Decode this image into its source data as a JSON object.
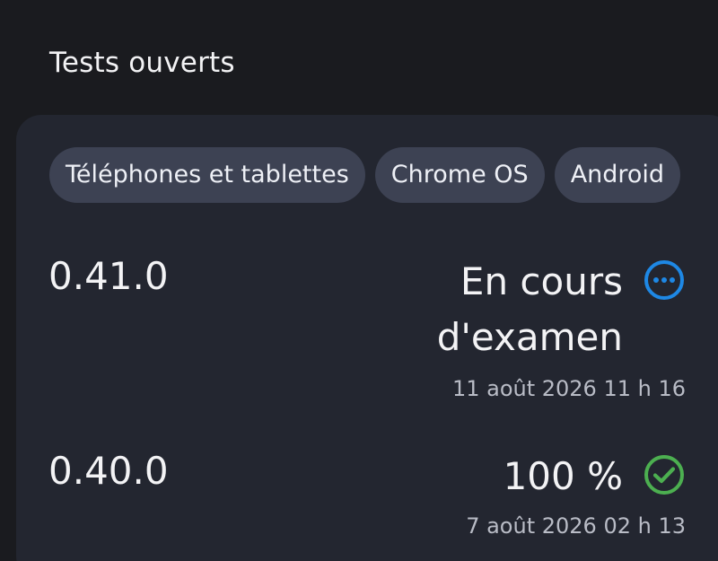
{
  "section": {
    "title": "Tests ouverts"
  },
  "chips": [
    {
      "label": "Téléphones et tablettes"
    },
    {
      "label": "Chrome OS"
    },
    {
      "label": "Android"
    }
  ],
  "releases": [
    {
      "version": "0.41.0",
      "status": "En cours d'examen",
      "status_icon": "more-horizontal-circle-icon",
      "status_color": "#1e88e5",
      "date": "11 août 2026 11 h 16"
    },
    {
      "version": "0.40.0",
      "status": "100 %",
      "status_icon": "check-circle-icon",
      "status_color": "#4caf50",
      "date": "7 août 2026 02 h 13"
    }
  ],
  "colors": {
    "background": "#1a1b1f",
    "card": "#232630",
    "chip": "#3d4253"
  }
}
